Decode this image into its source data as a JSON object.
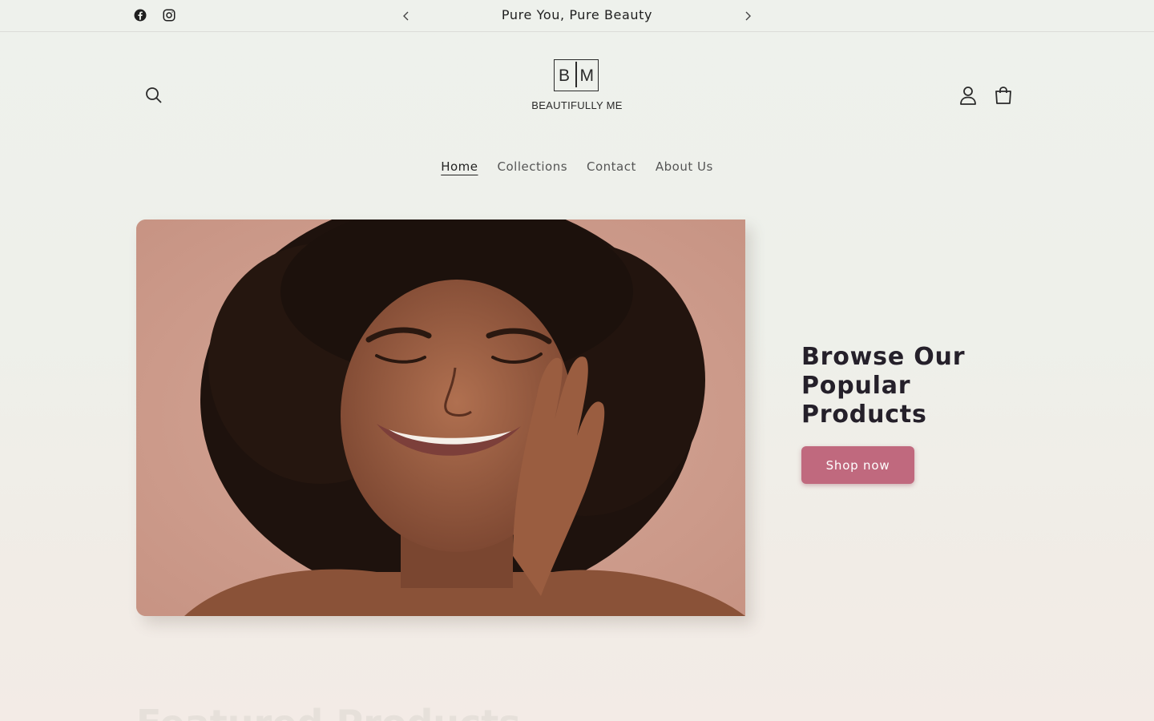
{
  "announcement": {
    "text": "Pure You, Pure Beauty",
    "social_icons": [
      "facebook-icon",
      "instagram-icon"
    ],
    "prev_icon": "chevron-left-icon",
    "next_icon": "chevron-right-icon"
  },
  "header": {
    "logo_monogram_left": "B",
    "logo_monogram_right": "M",
    "logo_text": "BEAUTIFULLY ME",
    "icons": [
      "search-icon",
      "account-icon",
      "cart-icon"
    ]
  },
  "nav": {
    "items": [
      {
        "label": "Home",
        "active": true
      },
      {
        "label": "Collections",
        "active": false
      },
      {
        "label": "Contact",
        "active": false
      },
      {
        "label": "About Us",
        "active": false
      }
    ]
  },
  "hero": {
    "title": "Browse Our Popular Products",
    "button_label": "Shop now"
  },
  "next_section": {
    "heading": "Featured Products"
  },
  "colors": {
    "accent": "#c0697e",
    "background": "#eef0ea",
    "text": "#25202a"
  }
}
